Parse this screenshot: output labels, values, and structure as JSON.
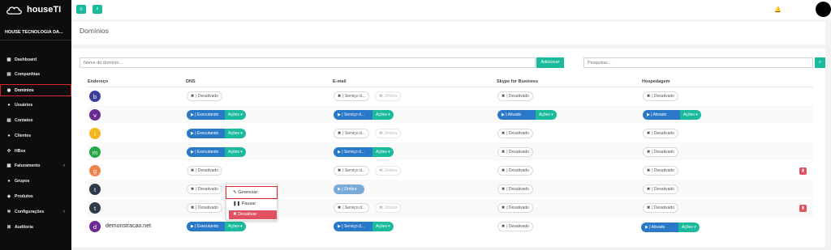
{
  "brand": {
    "name": "houseTI",
    "company": "HOUSE TECNOLOGIA DA..."
  },
  "sidebar": {
    "items": [
      {
        "label": "Dashboard",
        "icon": "dashboard-icon",
        "glyph": "▦"
      },
      {
        "label": "Companhias",
        "icon": "building-icon",
        "glyph": "▤"
      },
      {
        "label": "Domínios",
        "icon": "globe-icon",
        "glyph": "◉"
      },
      {
        "label": "Usuários",
        "icon": "user-icon",
        "glyph": "●"
      },
      {
        "label": "Contatos",
        "icon": "address-book-icon",
        "glyph": "▤"
      },
      {
        "label": "Clientes",
        "icon": "users-icon",
        "glyph": "●"
      },
      {
        "label": "HBox",
        "icon": "box-icon",
        "glyph": "✣"
      },
      {
        "label": "Faturamento",
        "icon": "money-icon",
        "glyph": "▦"
      },
      {
        "label": "Grupos",
        "icon": "group-icon",
        "glyph": "●"
      },
      {
        "label": "Produtos",
        "icon": "cubes-icon",
        "glyph": "◈"
      },
      {
        "label": "Configurações",
        "icon": "gear-icon",
        "glyph": "✲"
      },
      {
        "label": "Auditoria",
        "icon": "list-icon",
        "glyph": "≣"
      }
    ]
  },
  "topbar": {
    "menu_icon": "≡",
    "search_icon": "⌕",
    "bell_icon": "🔔"
  },
  "page": {
    "title": "Domínios"
  },
  "filters": {
    "domain_placeholder": "Nome do domínio...",
    "add_label": "Adicionar",
    "search_placeholder": "Pesquisar...",
    "search_icon": "⌕"
  },
  "table": {
    "headers": [
      "Endereço",
      "DNS",
      "E-mail",
      "Skype for Business",
      "Hospedagem"
    ],
    "rows": [
      {
        "letter": "b",
        "color": "#3b3f9c",
        "name": ""
      },
      {
        "letter": "v",
        "color": "#6a2a91",
        "name": ""
      },
      {
        "letter": "i",
        "color": "#f3b61f",
        "name": ""
      },
      {
        "letter": "m",
        "color": "#27a844",
        "name": ""
      },
      {
        "letter": "g",
        "color": "#f0824a",
        "name": ""
      },
      {
        "letter": "t",
        "color": "#2f3a4a",
        "name": ""
      },
      {
        "letter": "t",
        "color": "#2f3a4a",
        "name": ""
      },
      {
        "letter": "d",
        "color": "#6a2a91",
        "name": "demonstracao.net"
      }
    ]
  },
  "status": {
    "desativado": "| Desativado",
    "executando": "| Executando",
    "servico": "| Serviço d...",
    "zimbra": "| Zimbra",
    "ativado": "| Ativado",
    "acoes": "Ações ▾",
    "x": "✖",
    "play": "▶"
  },
  "dropdown": {
    "gerenciar": "✎ Gerenciar",
    "pausar": "❚❚ Pausar",
    "desativar": "✖ Desativar"
  },
  "colors": {
    "accent": "#1abb9c",
    "primary": "#2a78c8",
    "danger": "#e05262",
    "highlight": "#d9232d"
  }
}
